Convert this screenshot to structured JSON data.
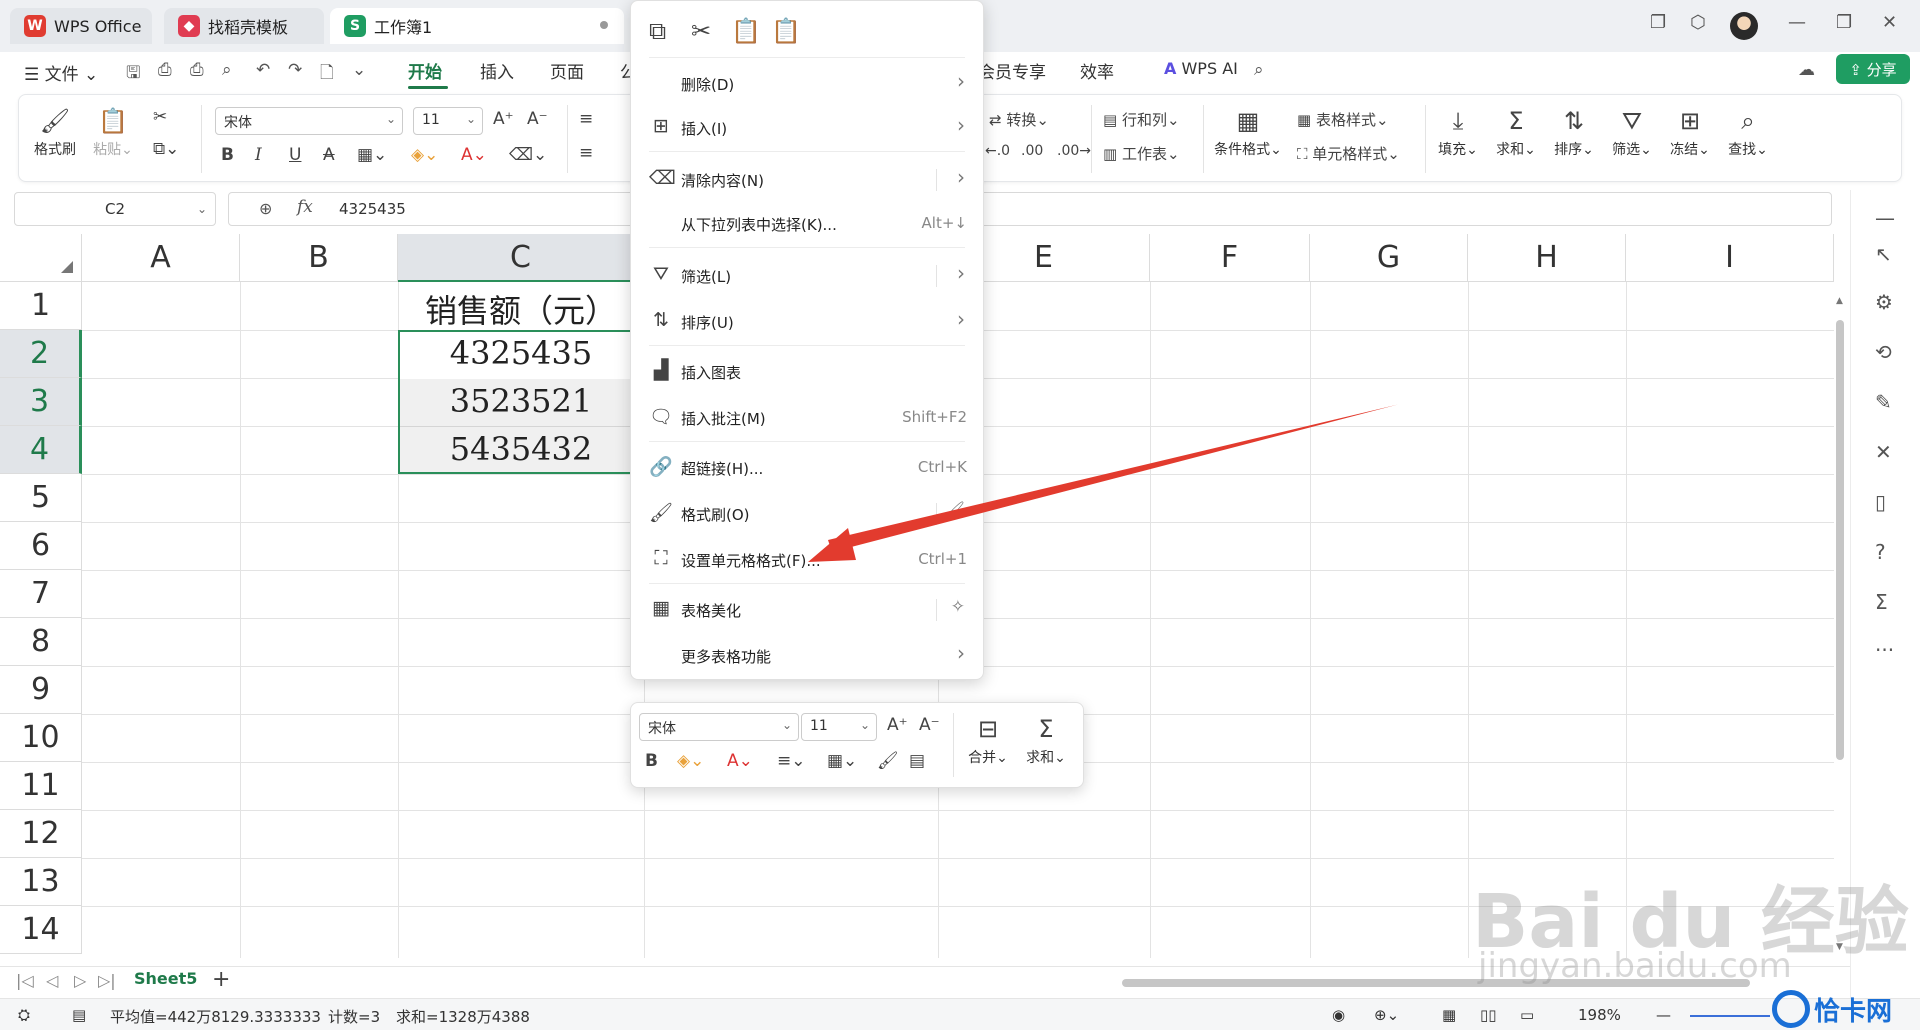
{
  "titlebar": {
    "tabs": [
      {
        "label": "WPS Office",
        "logo": "W",
        "color": "#e03c31"
      },
      {
        "label": "找稻壳模板",
        "logo": "◆",
        "color": "#e03c52"
      },
      {
        "label": "工作簿1",
        "logo": "S",
        "color": "#1f9d62"
      }
    ]
  },
  "menubar": {
    "file": "☰ 文件 ⌄",
    "items": [
      "开始",
      "插入",
      "页面",
      "公",
      "会员专享",
      "效率",
      "WPS AI"
    ],
    "share": "⇪ 分享"
  },
  "ribbon": {
    "format_painter": "格式刷",
    "paste": "粘贴⌄",
    "font_name": "宋体",
    "font_size": "11",
    "convert": "转换⌄",
    "row_col": "行和列⌄",
    "worksheet": "工作表⌄",
    "cond_format": "条件格式⌄",
    "table_style": "表格样式⌄",
    "cell_style": "单元格样式⌄",
    "fill": "填充⌄",
    "sum": "求和⌄",
    "sort": "排序⌄",
    "filter": "筛选⌄",
    "freeze": "冻结⌄",
    "find": "查找⌄"
  },
  "formula": {
    "cell_ref": "C2",
    "fx": "fx",
    "value": "4325435"
  },
  "grid": {
    "columns": [
      "A",
      "B",
      "C",
      "D",
      "E",
      "F",
      "G",
      "H",
      "I"
    ],
    "rows": [
      "1",
      "2",
      "3",
      "4",
      "5",
      "6",
      "7",
      "8",
      "9",
      "10",
      "11",
      "12",
      "13",
      "14"
    ],
    "c1": "销售额（元）",
    "c2": "4325435",
    "c3": "3523521",
    "c4": "5435432"
  },
  "context_menu": {
    "items": [
      {
        "label": "删除(D)",
        "shortcut": ""
      },
      {
        "label": "插入(I)",
        "shortcut": ""
      },
      {
        "label": "清除内容(N)",
        "shortcut": ""
      },
      {
        "label": "从下拉列表中选择(K)...",
        "shortcut": "Alt+↓"
      },
      {
        "label": "筛选(L)",
        "shortcut": ""
      },
      {
        "label": "排序(U)",
        "shortcut": ""
      },
      {
        "label": "插入图表",
        "shortcut": ""
      },
      {
        "label": "插入批注(M)",
        "shortcut": "Shift+F2"
      },
      {
        "label": "超链接(H)...",
        "shortcut": "Ctrl+K"
      },
      {
        "label": "格式刷(O)",
        "shortcut": ""
      },
      {
        "label": "设置单元格格式(F)...",
        "shortcut": "Ctrl+1"
      },
      {
        "label": "表格美化",
        "shortcut": ""
      },
      {
        "label": "更多表格功能",
        "shortcut": ""
      }
    ]
  },
  "mini_toolbar": {
    "font_name": "宋体",
    "font_size": "11",
    "merge": "合并⌄",
    "sum": "求和⌄"
  },
  "sheets": {
    "active": "Sheet5",
    "add": "+"
  },
  "status": {
    "average": "平均值=442万8129.3333333",
    "count": "计数=3",
    "sum": "求和=1328万4388",
    "zoom": "198%"
  },
  "watermark": {
    "baidu": "Bai  du 经验",
    "url": "jingyan.baidu.com",
    "brand": "恰卡网"
  },
  "colors": {
    "accent": "#1f7a4a",
    "arrow": "#e23b2e"
  }
}
